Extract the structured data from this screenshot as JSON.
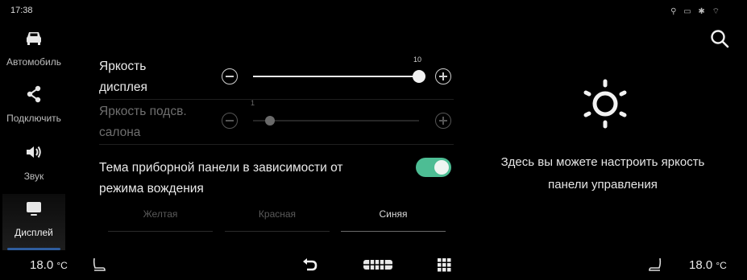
{
  "status": {
    "time": "17:38",
    "icons": [
      "usb-icon",
      "battery-icon",
      "bluetooth-icon",
      "wifi-icon"
    ]
  },
  "sidebar": {
    "items": [
      {
        "label": "Автомобиль",
        "icon": "car-icon",
        "active": false
      },
      {
        "label": "Подключить",
        "icon": "share-icon",
        "active": false
      },
      {
        "label": "Звук",
        "icon": "speaker-icon",
        "active": false
      },
      {
        "label": "Дисплей",
        "icon": "display-icon",
        "active": true
      }
    ]
  },
  "settings": {
    "display_brightness": {
      "label_line1": "Яркость",
      "label_line2": "дисплея",
      "value": "10",
      "max": 10,
      "enabled": true
    },
    "cabin_brightness": {
      "label_line1": "Яркость подсв.",
      "label_line2": "салона",
      "value": "1",
      "max": 10,
      "enabled": false
    },
    "theme_toggle": {
      "label_line1": "Тема приборной панели в зависимости от",
      "label_line2": "режима вождения",
      "on": true
    },
    "theme_tabs": [
      {
        "label": "Желтая",
        "selected": false
      },
      {
        "label": "Красная",
        "selected": false
      },
      {
        "label": "Синяя",
        "selected": true
      }
    ]
  },
  "info_panel": {
    "icon": "sun-brightness-icon",
    "text_line1": "Здесь вы можете настроить яркость",
    "text_line2": "панели управления"
  },
  "bottom_bar": {
    "left_temp": "18.0",
    "right_temp": "18.0",
    "temp_unit": "°C",
    "icons": [
      "seat-left-icon",
      "back-icon",
      "home-icon",
      "apps-grid-icon",
      "seat-right-icon"
    ]
  },
  "colors": {
    "accent_toggle": "#4dbd94",
    "active_indicator": "#2f5d9e",
    "background": "#000000"
  }
}
